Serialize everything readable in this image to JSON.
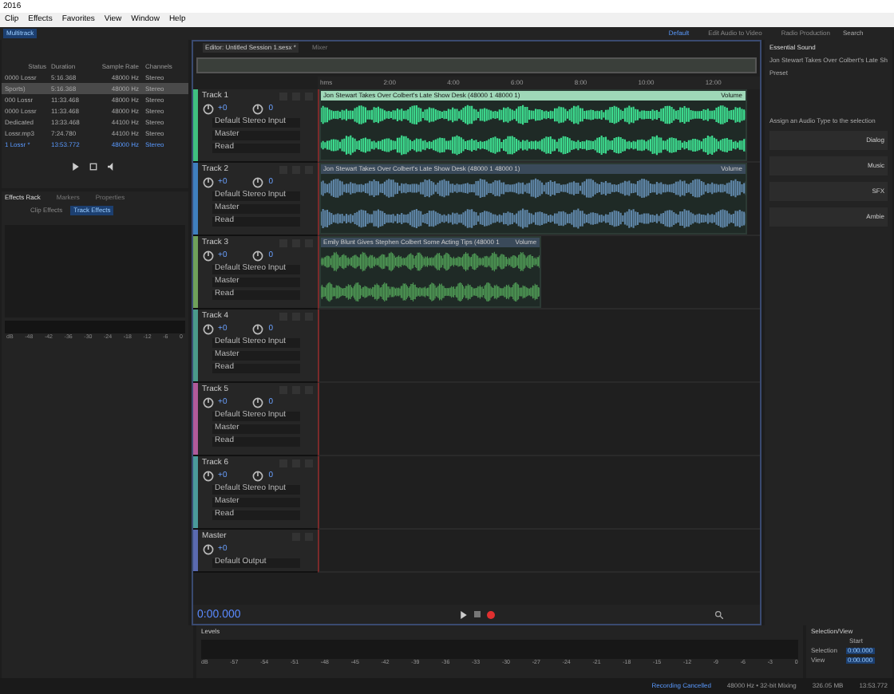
{
  "window": {
    "title": "2016"
  },
  "menu": [
    "Clip",
    "Effects",
    "Favorites",
    "View",
    "Window",
    "Help"
  ],
  "toolbar": {
    "mode_tabs": [
      {
        "label": "Multitrack",
        "selected": true
      }
    ],
    "workspaces": [
      {
        "label": "Default",
        "selected": true
      },
      {
        "label": "Edit Audio to Video",
        "selected": false
      },
      {
        "label": "Radio Production",
        "selected": false
      }
    ],
    "search": {
      "placeholder": "Search"
    }
  },
  "files": {
    "columns": [
      "Status",
      "Duration",
      "Sample Rate",
      "Channels"
    ],
    "rows": [
      {
        "name": "0000 Lossr",
        "duration": "5:16.368",
        "sample_rate": "48000 Hz",
        "channels": "Stereo",
        "selected": false,
        "session": false
      },
      {
        "name": "Sports)",
        "duration": "5:16.368",
        "sample_rate": "48000 Hz",
        "channels": "Stereo",
        "selected": true,
        "session": false
      },
      {
        "name": "000 Lossr",
        "duration": "11:33.468",
        "sample_rate": "48000 Hz",
        "channels": "Stereo",
        "selected": false,
        "session": false
      },
      {
        "name": "0000 Lossr",
        "duration": "11:33.468",
        "sample_rate": "48000 Hz",
        "channels": "Stereo",
        "selected": false,
        "session": false
      },
      {
        "name": "Dedicated",
        "duration": "13:33.468",
        "sample_rate": "44100 Hz",
        "channels": "Stereo",
        "selected": false,
        "session": false
      },
      {
        "name": "Lossr.mp3",
        "duration": "7:24.780",
        "sample_rate": "44100 Hz",
        "channels": "Stereo",
        "selected": false,
        "session": false
      },
      {
        "name": "1 Lossr *",
        "duration": "13:53.772",
        "sample_rate": "48000 Hz",
        "channels": "Stereo",
        "selected": false,
        "session": true
      }
    ]
  },
  "effects": {
    "tabs": [
      {
        "label": "Effects Rack",
        "selected": true
      },
      {
        "label": "Markers",
        "selected": false
      },
      {
        "label": "Properties",
        "selected": false
      }
    ],
    "subtabs": [
      {
        "label": "Clip Effects",
        "selected": false
      },
      {
        "label": "Track Effects",
        "selected": true
      }
    ],
    "scale": [
      "dB",
      "-48",
      "-42",
      "-36",
      "-30",
      "-24",
      "-18",
      "-12",
      "-6",
      "0"
    ]
  },
  "editor": {
    "tabs": [
      {
        "label": "Editor: Untitled Session 1.sesx *",
        "selected": true
      },
      {
        "label": "Mixer",
        "selected": false
      }
    ],
    "ruler": [
      "hms",
      "2:00",
      "4:00",
      "6:00",
      "8:00",
      "10:00",
      "12:00"
    ],
    "tracks": [
      {
        "kind": "track",
        "name": "Track 1",
        "color": "#3fbf7f",
        "volume": "+0",
        "pan": "0",
        "input": "Default Stereo Input",
        "output": "Master",
        "mode": "Read",
        "clip": {
          "kind": "full",
          "selected": true,
          "title": "Jon Stewart Takes Over Colbert's Late Show Desk (48000 1 48000 1)",
          "label": "Volume"
        }
      },
      {
        "kind": "track",
        "name": "Track 2",
        "color": "#3f7fbf",
        "volume": "+0",
        "pan": "0",
        "input": "Default Stereo Input",
        "output": "Master",
        "mode": "Read",
        "clip": {
          "kind": "full",
          "selected": false,
          "title": "Jon Stewart Takes Over Colbert's Late Show Desk (48000 1 48000 1)",
          "label": "Volume"
        }
      },
      {
        "kind": "track",
        "name": "Track 3",
        "color": "#6fa05a",
        "volume": "+0",
        "pan": "0",
        "input": "Default Stereo Input",
        "output": "Master",
        "mode": "Read",
        "clip": {
          "kind": "short",
          "selected": false,
          "title": "Emily Blunt Gives Stephen Colbert Some Acting Tips (48000 1",
          "label": "Volume"
        }
      },
      {
        "kind": "track",
        "name": "Track 4",
        "color": "#4a9a8a",
        "volume": "+0",
        "pan": "0",
        "input": "Default Stereo Input",
        "output": "Master",
        "mode": "Read"
      },
      {
        "kind": "track",
        "name": "Track 5",
        "color": "#b05a9a",
        "volume": "+0",
        "pan": "0",
        "input": "Default Stereo Input",
        "output": "Master",
        "mode": "Read"
      },
      {
        "kind": "track",
        "name": "Track 6",
        "color": "#4a9a9a",
        "volume": "+0",
        "pan": "0",
        "input": "Default Stereo Input",
        "output": "Master",
        "mode": "Read"
      },
      {
        "kind": "master",
        "name": "Master",
        "color": "#5a6ab0",
        "volume": "+0",
        "output": "Default Output"
      }
    ],
    "time": "0:00.000"
  },
  "essential_sound": {
    "title": "Essential Sound",
    "clip": "Jon Stewart Takes Over Colbert's Late Sh",
    "preset": "Preset",
    "prompt": "Assign an Audio Type to the selection",
    "types": [
      "Dialog",
      "Music",
      "SFX",
      "Ambie"
    ]
  },
  "levels": {
    "title": "Levels",
    "scale": [
      "dB",
      "-57",
      "-54",
      "-51",
      "-48",
      "-45",
      "-42",
      "-39",
      "-36",
      "-33",
      "-30",
      "-27",
      "-24",
      "-21",
      "-18",
      "-15",
      "-12",
      "-9",
      "-6",
      "-3",
      "0"
    ]
  },
  "selection_view": {
    "title": "Selection/View",
    "column": "Start",
    "rows": [
      {
        "label": "Selection",
        "start": "0:00.000"
      },
      {
        "label": "View",
        "start": "0:00.000"
      }
    ]
  },
  "status_bar": [
    {
      "text": "Recording Cancelled",
      "kind": "info"
    },
    {
      "text": "48000 Hz • 32-bit Mixing",
      "kind": "plain"
    },
    {
      "text": "326.05 MB",
      "kind": "plain"
    },
    {
      "text": "13:53.772",
      "kind": "plain"
    }
  ]
}
